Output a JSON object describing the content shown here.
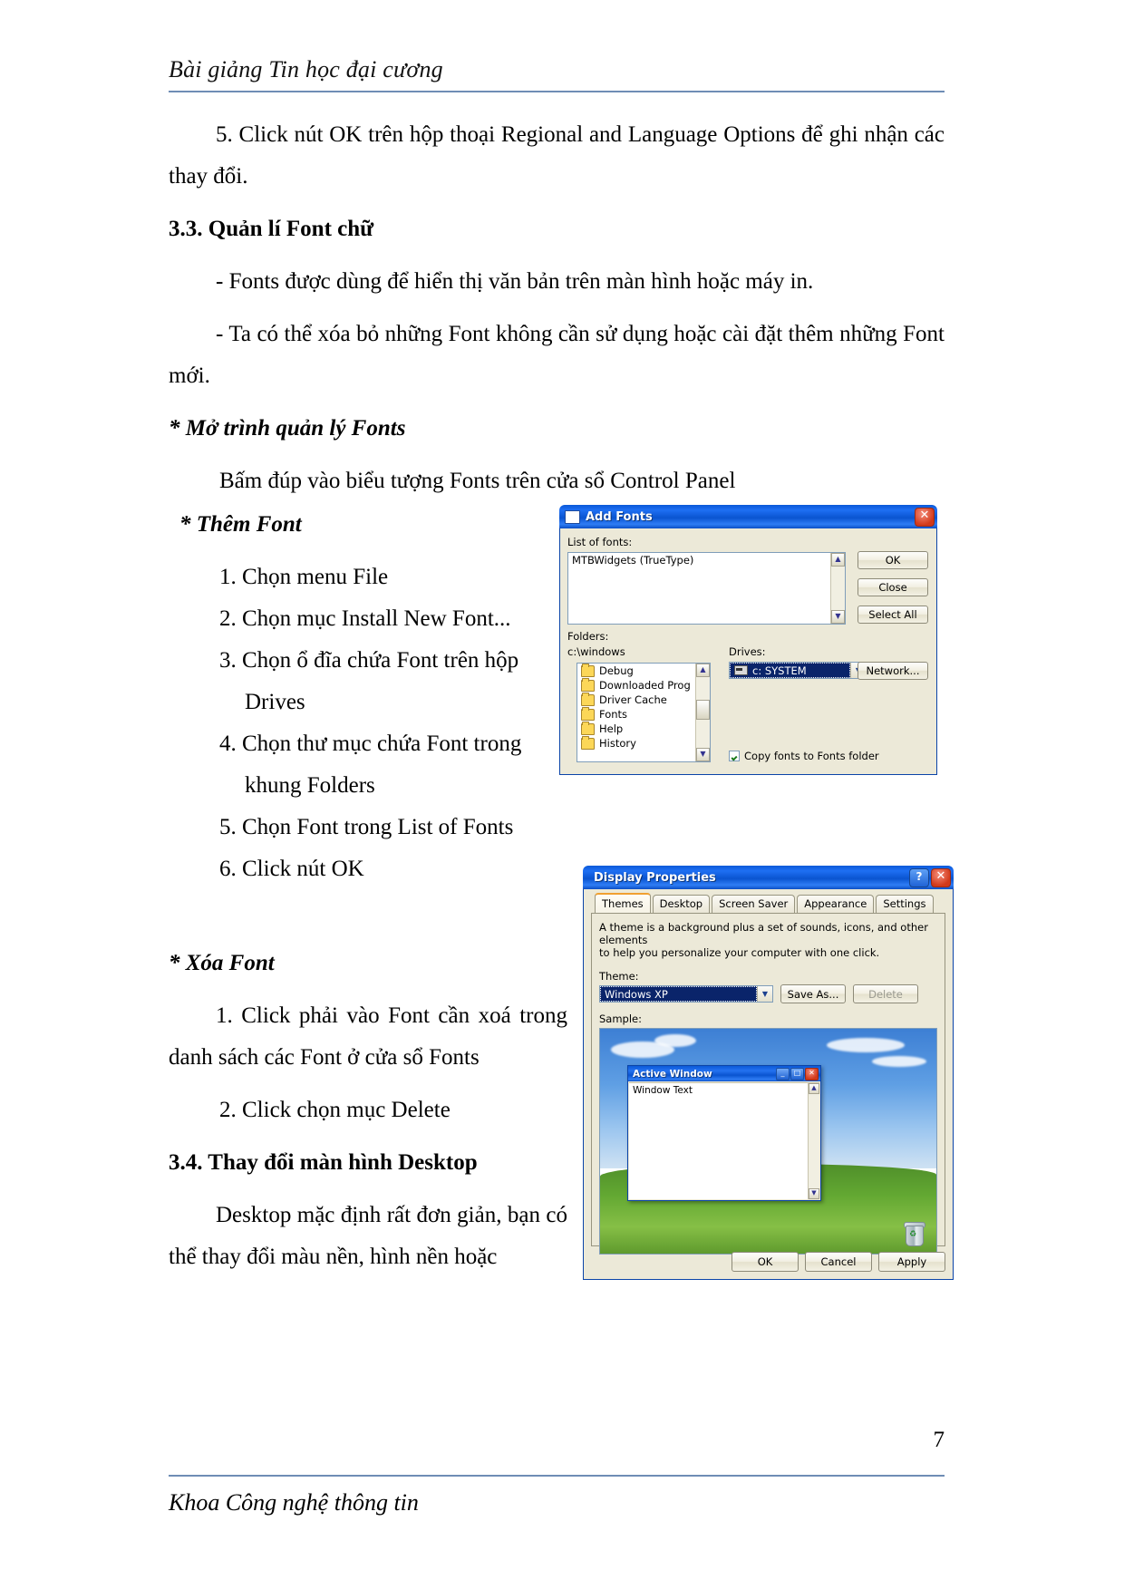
{
  "header": {
    "title": "Bài giảng Tin học đại cương"
  },
  "footer": {
    "left": "Khoa Công nghệ thông tin",
    "page_number": "7"
  },
  "body": {
    "step5": "5.  Click nút OK  trên hộp thoại Regional and Language Options để ghi nhận các thay đổi.",
    "heading_3_3": "3.3. Quản lí Font chữ",
    "bullet_1": "- Fonts được dùng để hiển thị văn bản trên màn hình hoặc máy in.",
    "bullet_2": "- Ta có thể xóa bỏ những Font không cần sử dụng hoặc cài đặt thêm những Font mới.",
    "star_open": "* Mở trình quản lý Fonts",
    "open_desc": "Bấm đúp vào biểu tượng Fonts trên cửa sổ Control Panel",
    "star_add": "* Thêm Font",
    "add_steps": [
      "1. Chọn menu File",
      "2. Chọn mục Install New Font...",
      "3. Chọn ổ đĩa chứa Font trên hộp",
      "Drives",
      "4. Chọn thư mục chứa Font trong",
      "khung Folders",
      "5. Chọn Font trong List of  Fonts",
      "6. Click nút OK"
    ],
    "star_delete": "* Xóa Font",
    "delete_steps": [
      "1. Click phải vào Font cần xoá trong danh sách các Font ở cửa sổ Fonts",
      "2. Click chọn mục Delete"
    ],
    "heading_3_4": "3.4. Thay đổi màn hình Desktop",
    "desktop_desc": "Desktop mặc định rất đơn giản, bạn có thể thay đổi màu nền, hình nền hoặc"
  },
  "add_fonts_dialog": {
    "title": "Add Fonts",
    "close_icon": "✕",
    "list_label": "List of fonts:",
    "fonts": [
      "MTBWidgets (TrueType)"
    ],
    "folders_label": "Folders:",
    "current_path": "c:\\windows",
    "folders": [
      "Debug",
      "Downloaded Prog",
      "Driver Cache",
      "Fonts",
      "Help",
      "History"
    ],
    "drives_label": "Drives:",
    "drive_selected": "c: SYSTEM",
    "copy_checkbox_label": "Copy fonts to Fonts folder",
    "copy_checked": true,
    "buttons": [
      "OK",
      "Close",
      "Select All",
      "Network..."
    ]
  },
  "display_properties_dialog": {
    "title": "Display Properties",
    "help_icon": "?",
    "close_icon": "✕",
    "tabs": [
      "Themes",
      "Desktop",
      "Screen Saver",
      "Appearance",
      "Settings"
    ],
    "active_tab": "Themes",
    "description_line1": "A theme is a background plus a set of sounds, icons, and other elements",
    "description_line2": "to help you personalize your computer with one click.",
    "theme_label": "Theme:",
    "theme_value": "Windows XP",
    "save_as_button": "Save As...",
    "delete_button": "Delete",
    "sample_label": "Sample:",
    "preview_window_title": "Active Window",
    "preview_window_text": "Window Text",
    "preview_minimize": "_",
    "preview_maximize": "□",
    "preview_close": "✕",
    "recycle_bin_label": "♻",
    "buttons": [
      "OK",
      "Cancel",
      "Apply"
    ]
  },
  "colors": {
    "rule": "#6f8db5",
    "xp_title_blue": "#0a54d0",
    "dialog_face": "#ece9d8",
    "selection_blue": "#0a246a"
  }
}
